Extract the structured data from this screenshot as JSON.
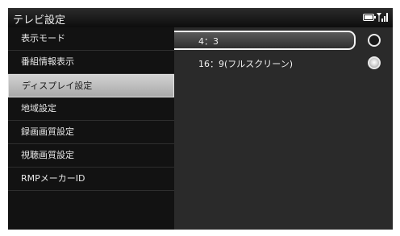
{
  "title_bar": {
    "title": "テレビ設定",
    "icons": [
      "battery-icon",
      "signal-icon"
    ]
  },
  "sidebar": {
    "items": [
      {
        "label": "表示モード",
        "selected": false
      },
      {
        "label": "番組情報表示",
        "selected": false
      },
      {
        "label": "ディスプレイ設定",
        "selected": true
      },
      {
        "label": "地域設定",
        "selected": false
      },
      {
        "label": "録画画質設定",
        "selected": false
      },
      {
        "label": "視聴画質設定",
        "selected": false
      },
      {
        "label": "RMPメーカーID",
        "selected": false
      }
    ]
  },
  "content": {
    "options": [
      {
        "label": "4：3",
        "highlighted": true,
        "checked": false
      },
      {
        "label": "16：9(フルスクリーン)",
        "highlighted": false,
        "checked": true
      }
    ]
  },
  "colors": {
    "screen_background": "#111111",
    "content_background": "#2a2a2a",
    "selected_item_background": "#c0c0c0",
    "text": "#f2f2f2"
  }
}
